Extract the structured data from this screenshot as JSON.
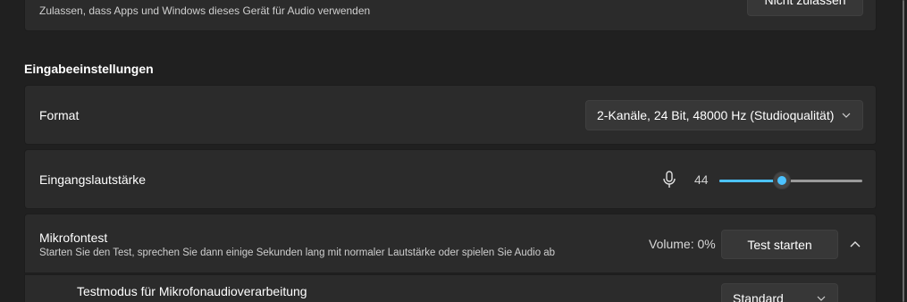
{
  "top_row": {
    "description": "Zulassen, dass Apps und Windows dieses Gerät für Audio verwenden",
    "deny_button": "Nicht zulassen"
  },
  "section": {
    "heading": "Eingabeeinstellungen"
  },
  "format_row": {
    "label": "Format",
    "value": "2-Kanäle, 24 Bit, 48000 Hz (Studioqualität)"
  },
  "volume_row": {
    "label": "Eingangslautstärke",
    "value": "44",
    "level": 44,
    "icon": "microphone-icon"
  },
  "mic_test_row": {
    "title": "Mikrofontest",
    "description": "Starten Sie den Test, sprechen Sie dann einige Sekunden lang mit normaler Lautstärke oder spielen Sie Audio ab",
    "volume": "Volume: 0%",
    "start_button": "Test starten",
    "collapse_icon": "chevron-up-icon"
  },
  "test_mode_row": {
    "label": "Testmodus für Mikrofonaudioverarbeitung",
    "value": "Standard"
  },
  "colors": {
    "background": "#202020",
    "card": "#2b2b2b",
    "accent": "#4cc2ff"
  }
}
